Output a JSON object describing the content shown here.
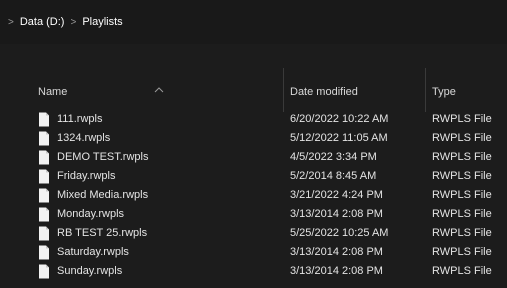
{
  "breadcrumb": {
    "items": [
      "Data (D:)",
      "Playlists"
    ],
    "separator": ">"
  },
  "columns": {
    "name": "Name",
    "date_modified": "Date modified",
    "type": "Type"
  },
  "files": [
    {
      "name": "111.rwpls",
      "date": "6/20/2022 10:22 AM",
      "type": "RWPLS File"
    },
    {
      "name": "1324.rwpls",
      "date": "5/12/2022 11:05 AM",
      "type": "RWPLS File"
    },
    {
      "name": "DEMO TEST.rwpls",
      "date": "4/5/2022 3:34 PM",
      "type": "RWPLS File"
    },
    {
      "name": "Friday.rwpls",
      "date": "5/2/2014 8:45 AM",
      "type": "RWPLS File"
    },
    {
      "name": "Mixed Media.rwpls",
      "date": "3/21/2022 4:24 PM",
      "type": "RWPLS File"
    },
    {
      "name": "Monday.rwpls",
      "date": "3/13/2014 2:08 PM",
      "type": "RWPLS File"
    },
    {
      "name": "RB TEST 25.rwpls",
      "date": "5/25/2022 10:25 AM",
      "type": "RWPLS File"
    },
    {
      "name": "Saturday.rwpls",
      "date": "3/13/2014 2:08 PM",
      "type": "RWPLS File"
    },
    {
      "name": "Sunday.rwpls",
      "date": "3/13/2014 2:08 PM",
      "type": "RWPLS File"
    }
  ],
  "icons": {
    "file": "file-icon",
    "sort": "chevron-up-icon"
  },
  "colors": {
    "background": "#1c1c1c",
    "text": "#e4e4e4",
    "divider": "#3a3a3a"
  }
}
